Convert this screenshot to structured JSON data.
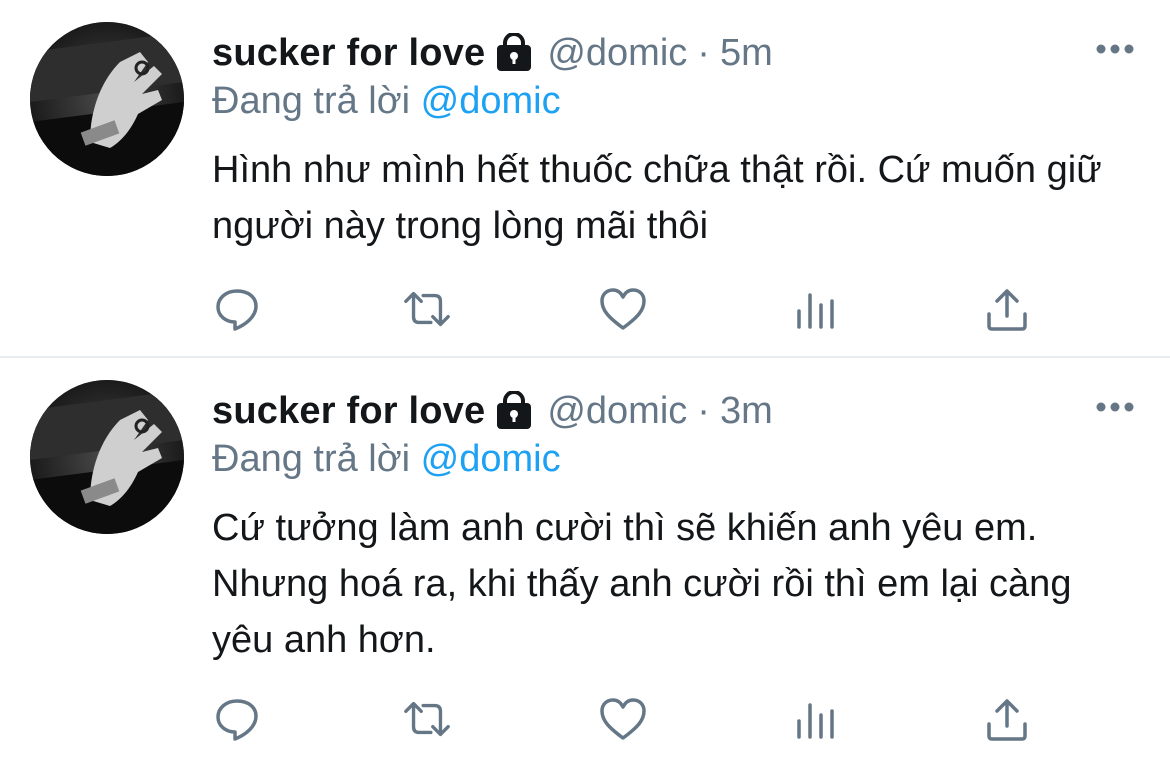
{
  "tweets": [
    {
      "display_name": "sucker for love",
      "handle": "@domic",
      "separator": "·",
      "time": "5m",
      "replying_prefix": "Đang trả lời",
      "replying_to": "@domic",
      "text": "Hình như mình hết thuốc chữa thật rồi. Cứ muốn giữ người này trong lòng mãi thôi",
      "protected_icon": "lock-icon",
      "actions": [
        "reply-icon",
        "retweet-icon",
        "like-icon",
        "analytics-icon",
        "share-icon"
      ]
    },
    {
      "display_name": "sucker for love",
      "handle": "@domic",
      "separator": "·",
      "time": "3m",
      "replying_prefix": "Đang trả lời",
      "replying_to": "@domic",
      "text": "Cứ tưởng làm anh cười thì sẽ khiến anh yêu em. Nhưng hoá ra, khi thấy anh cười rồi thì em lại càng yêu anh hơn.",
      "protected_icon": "lock-icon",
      "actions": [
        "reply-icon",
        "retweet-icon",
        "like-icon",
        "analytics-icon",
        "share-icon"
      ]
    }
  ],
  "colors": {
    "text": "#14171a",
    "secondary": "#657786",
    "link": "#1da1f2",
    "divider": "#e6ecf0"
  }
}
